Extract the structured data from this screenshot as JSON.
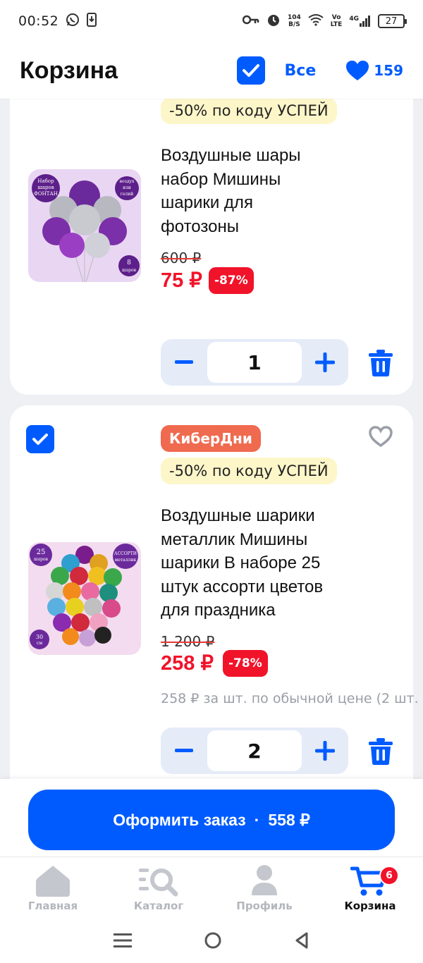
{
  "status_bar": {
    "time": "00:52",
    "net_speed_value": "104",
    "net_speed_unit": "B/S",
    "volte_top": "Vo",
    "volte_bottom": "LTE",
    "network": "4G",
    "battery": "27"
  },
  "header": {
    "title": "Корзина",
    "select_all_label": "Все",
    "favorites_count": "159"
  },
  "items": [
    {
      "promo_label": "-50% по коду УСПЕЙ",
      "name_lines": [
        "Воздушные шары",
        "набор Мишины",
        "шарики для",
        "фотозоны"
      ],
      "old_price": "600 ₽",
      "price": "75 ₽",
      "discount": "-87%",
      "quantity": "1",
      "image_text": {
        "left": [
          "Набор",
          "шаров",
          "ФОНТАН"
        ],
        "right": [
          "воздух",
          "или",
          "гелий"
        ],
        "count": [
          "8",
          "шаров"
        ]
      }
    },
    {
      "tag_label": "КиберДни",
      "promo_label": "-50% по коду УСПЕЙ",
      "name_lines": [
        "Воздушные шарики",
        "металлик Мишины",
        "шарики В наборе 25",
        "штук ассорти цветов",
        "для праздника"
      ],
      "old_price": "1 200 ₽",
      "price": "258 ₽",
      "discount": "-78%",
      "regular_price_note": "258 ₽ за шт. по обычной цене (2 шт.",
      "quantity": "2",
      "image_text": {
        "count": [
          "25",
          "шаров"
        ],
        "right": [
          "АССОРТИ",
          "металлик"
        ],
        "size": [
          "30",
          "см"
        ]
      }
    }
  ],
  "checkout": {
    "label": "Оформить заказ",
    "separator": "·",
    "total": "558 ₽"
  },
  "bottom_nav": [
    {
      "label": "Главная"
    },
    {
      "label": "Каталог"
    },
    {
      "label": "Профиль"
    },
    {
      "label": "Корзина",
      "badge": "6"
    }
  ],
  "colors": {
    "accent": "#005bff",
    "price_red": "#f1132a",
    "promo_bg": "#fdf6c9",
    "tag_bg": "#ef6a4f"
  }
}
